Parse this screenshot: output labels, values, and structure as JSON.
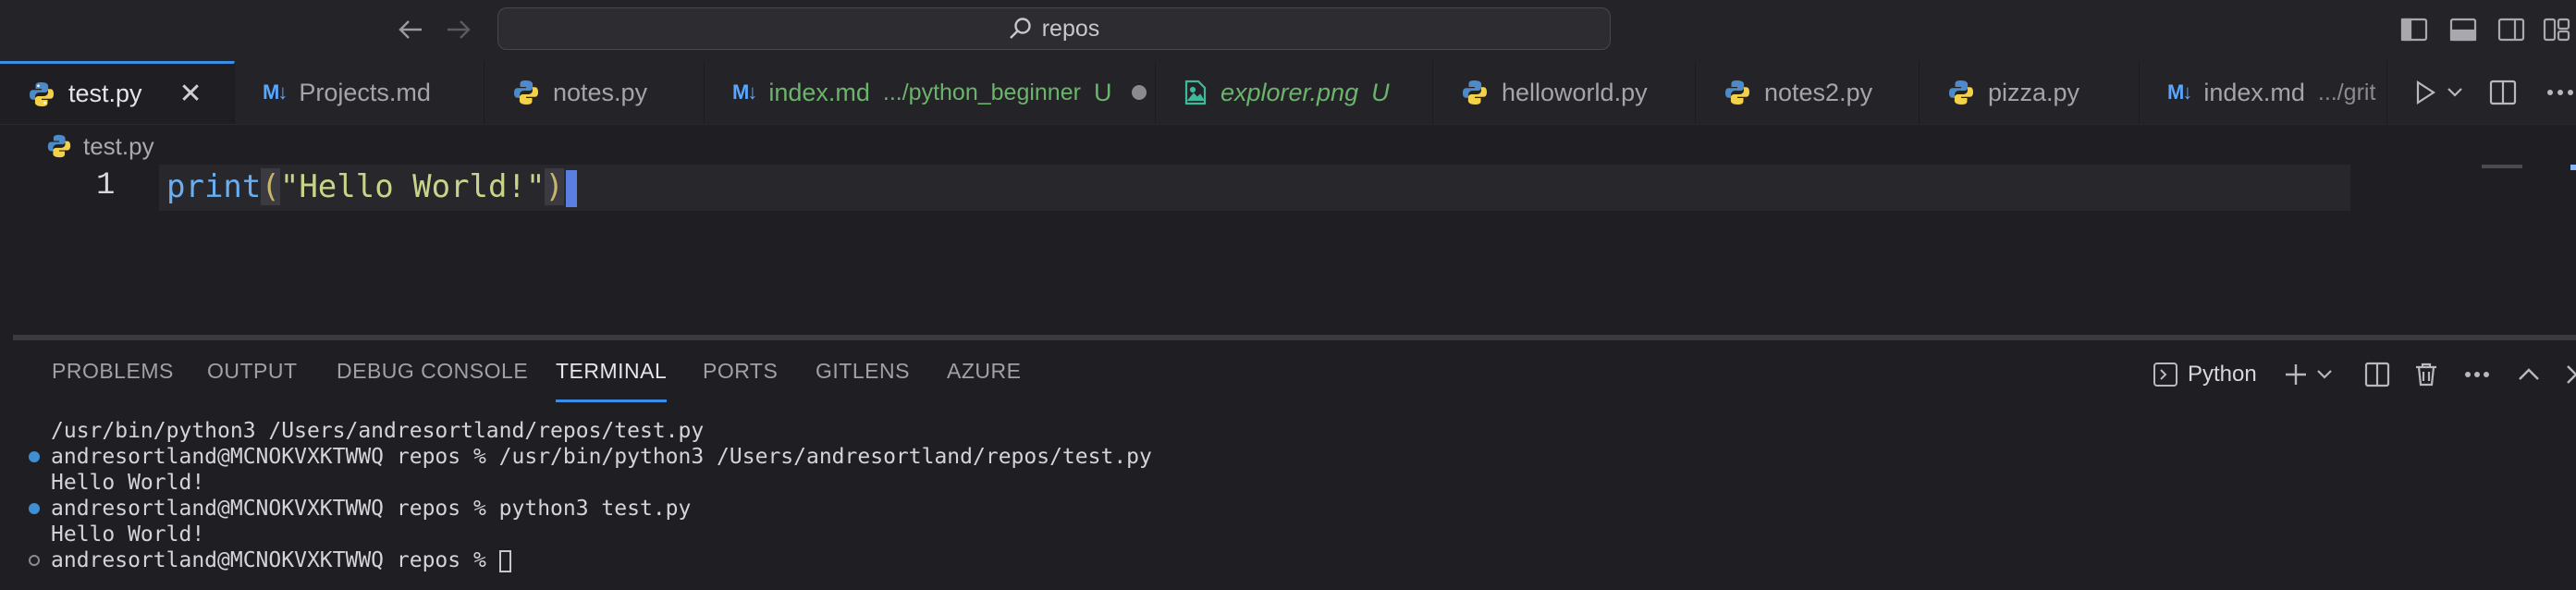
{
  "window": {
    "search_text": "repos"
  },
  "tabs": [
    {
      "label": "test.py",
      "icon": "python-icon",
      "active": true
    },
    {
      "label": "Projects.md",
      "icon": "markdown-icon"
    },
    {
      "label": "notes.py",
      "icon": "python-icon"
    },
    {
      "label": "index.md",
      "icon": "markdown-icon",
      "description": ".../python_beginner",
      "status": "U"
    },
    {
      "label": "explorer.png",
      "icon": "image-icon",
      "status": "U"
    },
    {
      "label": "helloworld.py",
      "icon": "python-icon"
    },
    {
      "label": "notes2.py",
      "icon": "python-icon"
    },
    {
      "label": "pizza.py",
      "icon": "python-icon"
    },
    {
      "label": "index.md",
      "icon": "markdown-icon",
      "description": ".../grit"
    }
  ],
  "markdown_glyph": "M↓",
  "breadcrumb": {
    "file": "test.py"
  },
  "editor": {
    "line_number": "1",
    "code_fn": "print",
    "code_open": "(",
    "code_str": "\"Hello World!\"",
    "code_close": ")"
  },
  "panel": {
    "tabs": [
      "PROBLEMS",
      "OUTPUT",
      "DEBUG CONSOLE",
      "TERMINAL",
      "PORTS",
      "GITLENS",
      "AZURE"
    ],
    "active_tab": "TERMINAL",
    "terminal_name": "Python",
    "terminal_lines": [
      {
        "text": "/usr/bin/python3 /Users/andresortland/repos/test.py",
        "marker": "none"
      },
      {
        "text": "andresortland@MCNOKVXKTWWQ repos % /usr/bin/python3 /Users/andresortland/repos/test.py",
        "marker": "blue"
      },
      {
        "text": "Hello World!",
        "marker": "none"
      },
      {
        "text": "andresortland@MCNOKVXKTWWQ repos % python3 test.py",
        "marker": "blue"
      },
      {
        "text": "Hello World!",
        "marker": "none"
      },
      {
        "text": "andresortland@MCNOKVXKTWWQ repos % ",
        "marker": "empty"
      }
    ]
  },
  "colors": {
    "accent": "#3b8ee8",
    "background": "#1f1f23",
    "modified_green": "#6bb46b"
  }
}
